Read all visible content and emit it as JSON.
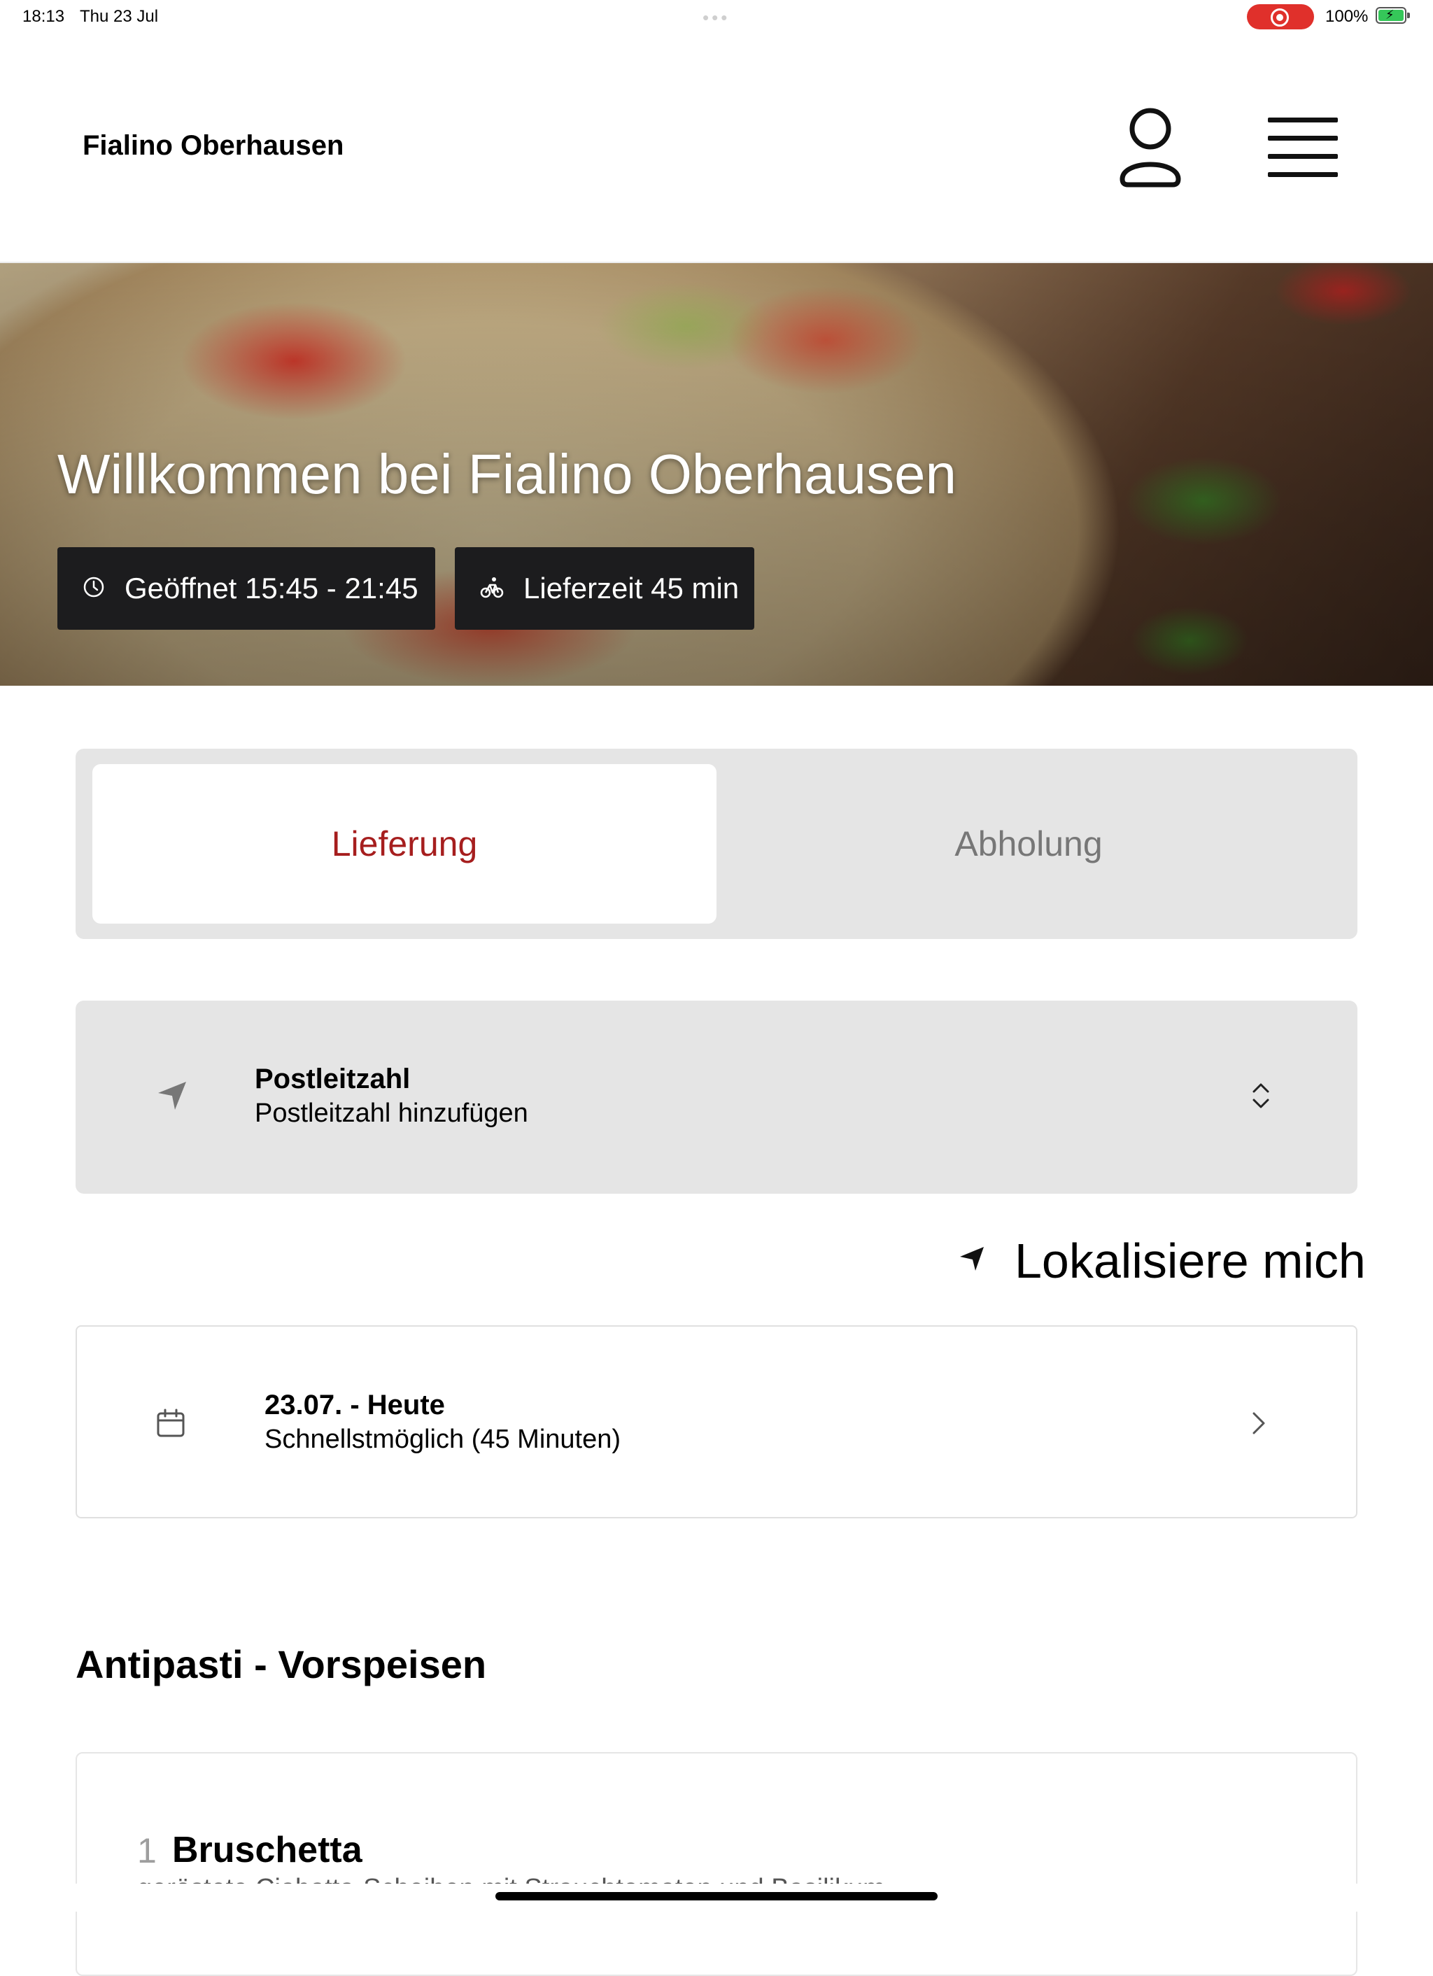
{
  "status_bar": {
    "time": "18:13",
    "date": "Thu 23 Jul",
    "battery_percent": "100%",
    "recording_color": "#e0302b",
    "battery_color": "#35c759"
  },
  "header": {
    "brand": "Fialino Oberhausen",
    "user_icon": "user-icon",
    "menu_icon": "hamburger-menu-icon"
  },
  "hero": {
    "title": "Willkommen bei Fialino Oberhausen",
    "opening_hours": "Geöffnet 15:45 - 21:45",
    "delivery_time": "Lieferzeit 45 min",
    "clock_icon": "clock-icon",
    "bike_icon": "bicycle-icon"
  },
  "order_mode": {
    "tabs": [
      {
        "label": "Lieferung",
        "active": true
      },
      {
        "label": "Abholung",
        "active": false
      }
    ],
    "accent_color": "#a61e1e"
  },
  "postcode": {
    "title": "Postleitzahl",
    "placeholder": "Postleitzahl hinzufügen"
  },
  "locate": {
    "label": "Lokalisiere mich"
  },
  "delivery_slot": {
    "date": "23.07. - Heute",
    "time": "Schnellstmöglich (45 Minuten)"
  },
  "menu": {
    "section_title": "Antipasti - Vorspeisen",
    "items": [
      {
        "number": "1",
        "name": "Bruschetta",
        "description": "geröstete Ciabatta-Scheiben mit Strauchtomaten und Basilikum"
      }
    ]
  }
}
